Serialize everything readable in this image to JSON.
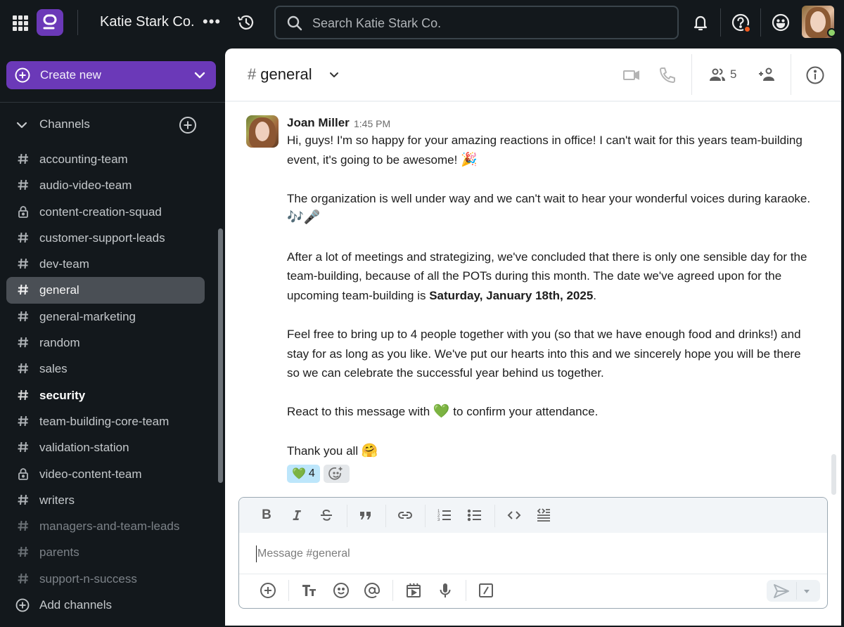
{
  "topbar": {
    "workspace_name": "Katie Stark Co.",
    "more_label": "•••",
    "search_placeholder": "Search Katie Stark Co.",
    "help_badge_color": "#f25b1f",
    "status_color": "#8fd16a"
  },
  "sidebar": {
    "create_label": "Create new",
    "channels_label": "Channels",
    "add_channels_label": "Add channels",
    "channels": [
      {
        "name": "accounting-team",
        "icon": "hash",
        "state": "normal"
      },
      {
        "name": "audio-video-team",
        "icon": "hash",
        "state": "normal"
      },
      {
        "name": "content-creation-squad",
        "icon": "lock",
        "state": "normal"
      },
      {
        "name": "customer-support-leads",
        "icon": "hash",
        "state": "normal"
      },
      {
        "name": "dev-team",
        "icon": "hash",
        "state": "normal"
      },
      {
        "name": "general",
        "icon": "hash",
        "state": "active"
      },
      {
        "name": "general-marketing",
        "icon": "hash",
        "state": "normal"
      },
      {
        "name": "random",
        "icon": "hash",
        "state": "normal"
      },
      {
        "name": "sales",
        "icon": "hash",
        "state": "normal"
      },
      {
        "name": "security",
        "icon": "hash",
        "state": "unread"
      },
      {
        "name": "team-building-core-team",
        "icon": "hash",
        "state": "normal"
      },
      {
        "name": "validation-station",
        "icon": "hash",
        "state": "normal"
      },
      {
        "name": "video-content-team",
        "icon": "lock",
        "state": "normal"
      },
      {
        "name": "writers",
        "icon": "hash",
        "state": "normal"
      },
      {
        "name": "managers-and-team-leads",
        "icon": "hash",
        "state": "muted"
      },
      {
        "name": "parents",
        "icon": "hash",
        "state": "muted"
      },
      {
        "name": "support-n-success",
        "icon": "hash",
        "state": "muted"
      }
    ]
  },
  "channel": {
    "hash": "#",
    "name": "general",
    "member_count": "5"
  },
  "message": {
    "author": "Joan Miller",
    "time": "1:45 PM",
    "p1": "Hi, guys! I'm so happy for your amazing reactions in office! I can't wait for this years team-building event, it's going to be awesome!",
    "p1_emoji": "🎉",
    "p2": "The organization is well under way and we can't wait to hear your wonderful voices during karaoke.",
    "p2_emoji": "🎶🎤",
    "p3_a": "After a lot of meetings and strategizing, we've concluded that there is only one sensible day for the team-building, because of all the POTs during this month. The date we've agreed upon for the upcoming team-building is ",
    "p3_bold": "Saturday, January 18th, 2025",
    "p3_end": ".",
    "p4": "Feel free to bring up to 4 people together with you (so that we have enough food and drinks!) and stay for as long as you like. We've put our hearts into this and we sincerely hope you will be there so we can celebrate the successful year behind us together.",
    "p5_a": "React to this message with",
    "p5_emoji": "💚",
    "p5_b": "to confirm your attendance.",
    "p6": "Thank you all",
    "p6_emoji": "🤗",
    "reactions": [
      {
        "emoji": "💚",
        "count": "4"
      }
    ]
  },
  "composer": {
    "placeholder": "Message #general"
  },
  "colors": {
    "brand": "#6b39b8",
    "sidebar_bg": "#13181c",
    "active_channel": "#4a4f55",
    "reaction_mine": "#bde6fb"
  }
}
